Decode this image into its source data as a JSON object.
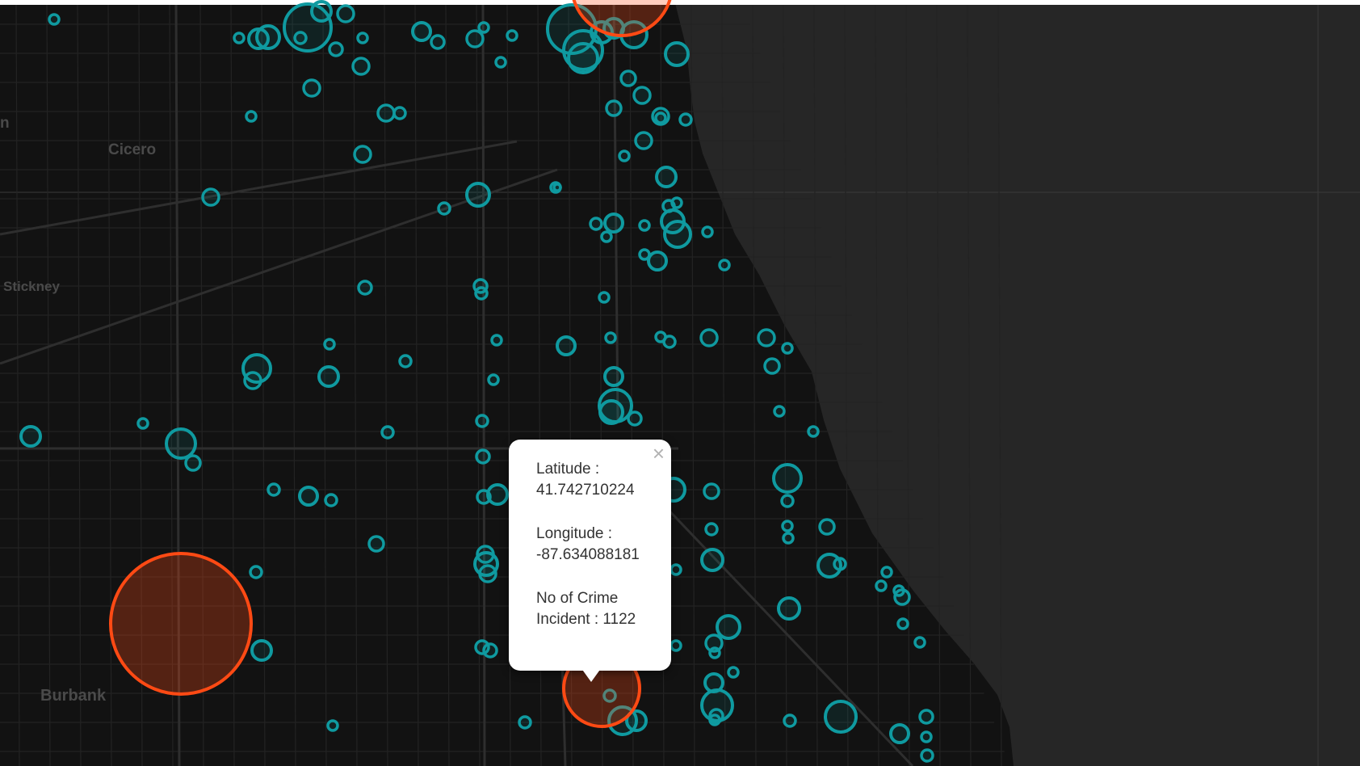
{
  "map": {
    "place_labels": [
      {
        "id": "cicero",
        "text": "Cicero"
      },
      {
        "id": "stickney",
        "text": "Stickney"
      },
      {
        "id": "burbank",
        "text": "Burbank"
      },
      {
        "id": "edge",
        "text": "n"
      }
    ],
    "colors": {
      "land": "#121212",
      "lake": "#262626",
      "roads": "#2b2b2b",
      "marker_teal": "#0f9aa0",
      "marker_orange": "#ff4a14"
    }
  },
  "popup": {
    "latitude_label": "Latitude :",
    "latitude_value": "41.742710224",
    "longitude_label": "Longitude :",
    "longitude_value": "-87.634088181",
    "crime_label": "No of Crime",
    "crime_value": "Incident : 1122",
    "close_glyph": "×"
  }
}
